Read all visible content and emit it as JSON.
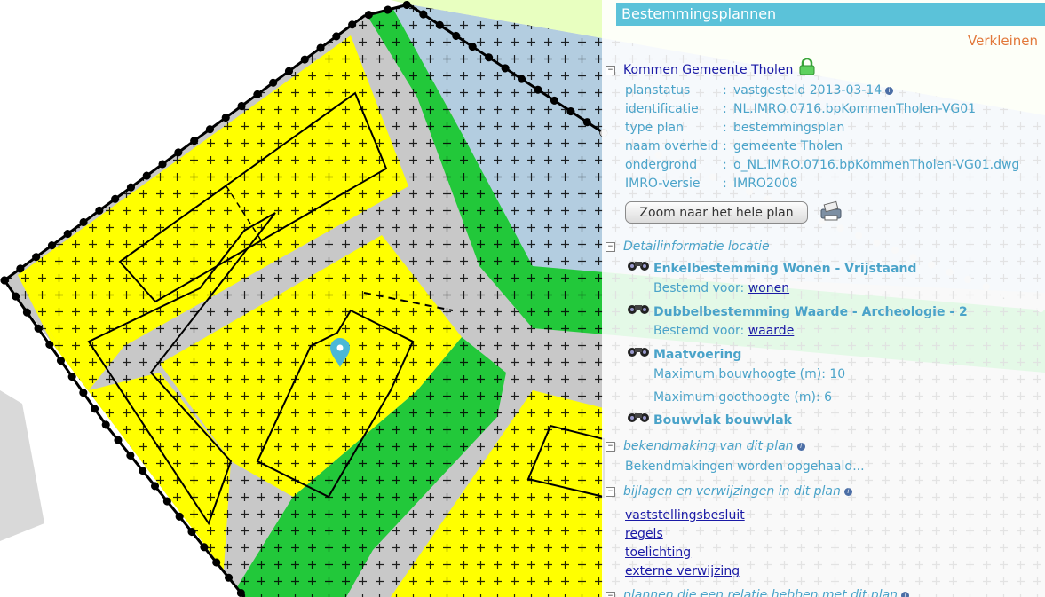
{
  "panel": {
    "title": "Bestemmingsplannen",
    "shrink_label": "Verkleinen",
    "plan": {
      "name": "Kommen Gemeente Tholen",
      "lock_icon": "green-lock-icon",
      "properties": [
        {
          "key": "planstatus",
          "value": "vastgesteld 2013-03-14",
          "info": true
        },
        {
          "key": "identificatie",
          "value": "NL.IMRO.0716.bpKommenTholen-VG01",
          "info": false
        },
        {
          "key": "type plan",
          "value": "bestemmingsplan",
          "info": false
        },
        {
          "key": "naam overheid",
          "value": "gemeente Tholen",
          "info": false
        },
        {
          "key": "ondergrond",
          "value": "o_NL.IMRO.0716.bpKommenTholen-VG01.dwg",
          "info": false
        },
        {
          "key": "IMRO-versie",
          "value": "IMRO2008",
          "info": false
        }
      ],
      "separator": ":",
      "zoom_button": "Zoom naar het hele plan"
    },
    "detail": {
      "heading": "Detailinformatie locatie",
      "features": [
        {
          "title": "Enkelbestemming Wonen - Vrijstaand",
          "lines": [
            {
              "label": "Bestemd voor:",
              "link": "wonen"
            }
          ]
        },
        {
          "title": "Dubbelbestemming Waarde - Archeologie - 2",
          "lines": [
            {
              "label": "Bestemd voor:",
              "link": "waarde"
            }
          ]
        },
        {
          "title": "Maatvoering",
          "lines": [
            {
              "label": "Maximum bouwhoogte (m): 10"
            },
            {
              "label": "Maximum goothoogte (m): 6"
            }
          ]
        },
        {
          "title": "Bouwvlak bouwvlak",
          "lines": []
        }
      ]
    },
    "announcement": {
      "heading": "bekendmaking van dit plan",
      "status": "Bekendmakingen worden opgehaald..."
    },
    "attachments": {
      "heading": "bijlagen en verwijzingen in dit plan",
      "links": [
        "vaststellingsbesluit",
        "regels",
        "toelichting",
        "externe verwijzing"
      ]
    },
    "related": {
      "heading": "plannen die een relatie hebben met dit plan"
    }
  },
  "map": {
    "colors": {
      "residential": "#ffff00",
      "green": "#22c83a",
      "road": "#c8c8c8",
      "water": "#b3cde0",
      "outside": "#e8ffc0",
      "marker": "#4bb8d6",
      "accent": "#5bc2d9"
    },
    "marker_icon": "location-pin-icon"
  }
}
